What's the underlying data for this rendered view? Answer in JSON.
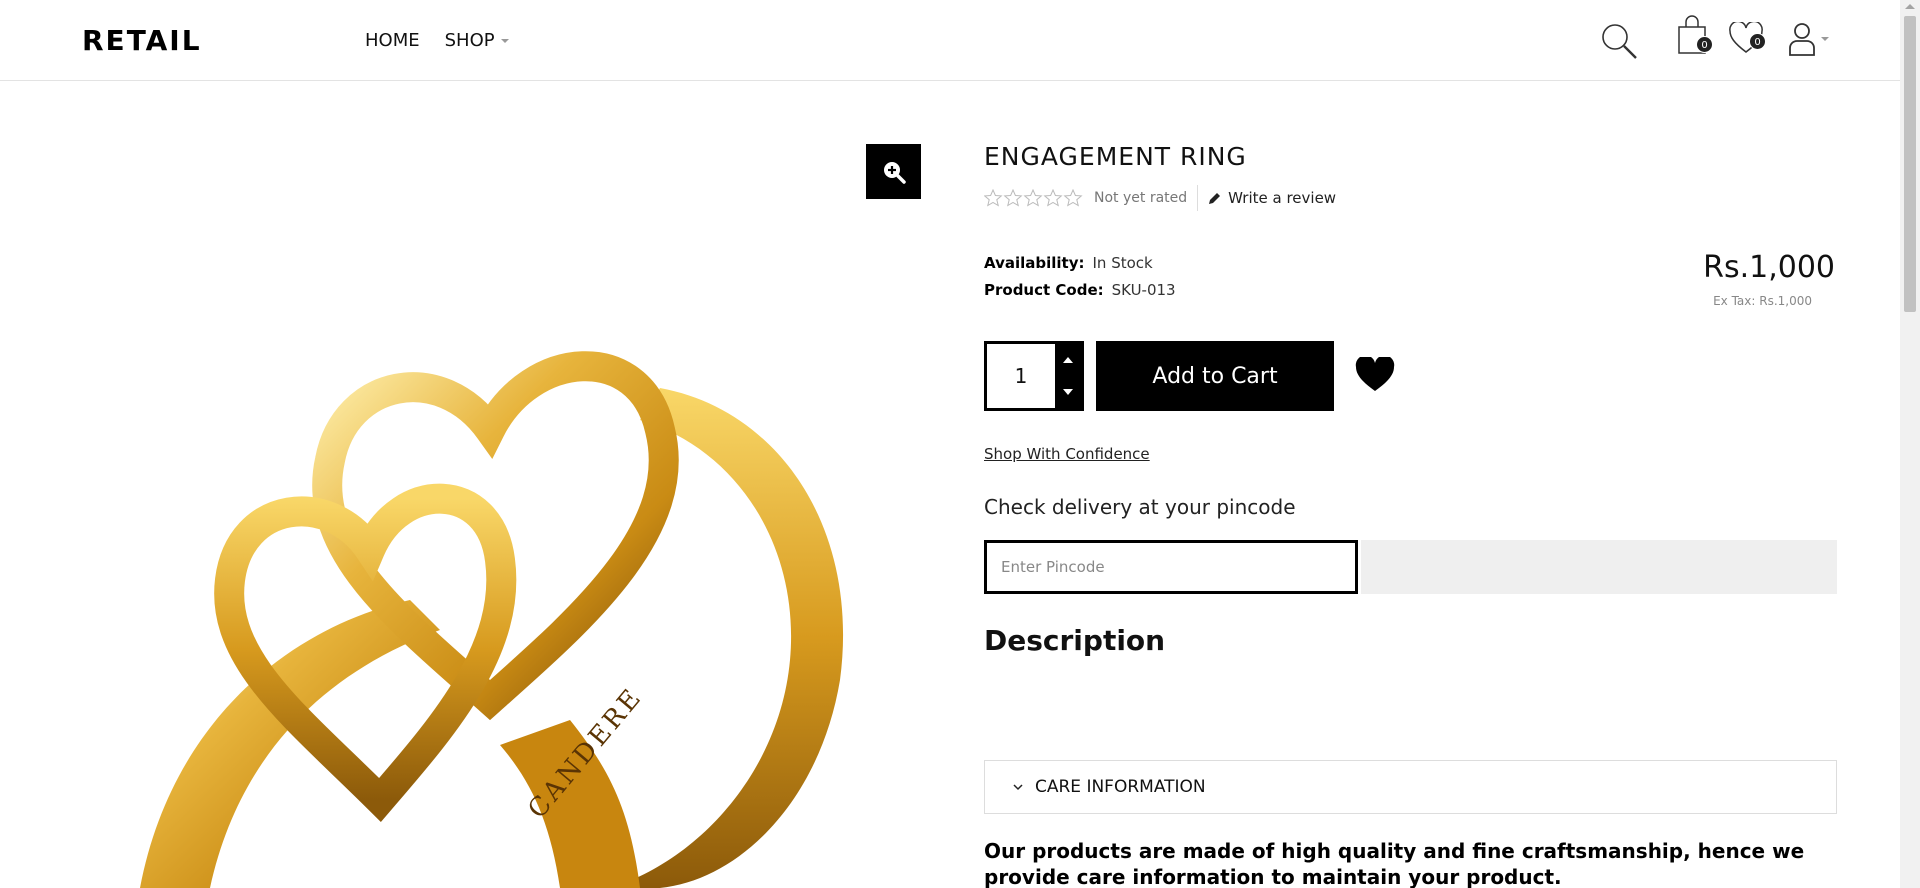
{
  "header": {
    "logo": "RETAIL",
    "nav": [
      {
        "label": "HOME"
      },
      {
        "label": "SHOP"
      }
    ],
    "cart_count": "0",
    "wishlist_count": "0"
  },
  "product": {
    "title": "ENGAGEMENT RING",
    "rating_text": "Not yet rated",
    "write_review": "Write a review",
    "availability_label": "Availability:",
    "availability_value": "In Stock",
    "code_label": "Product Code:",
    "code_value": "SKU-013",
    "price": "Rs.1,000",
    "ex_tax": "Ex Tax: Rs.1,000",
    "quantity": "1",
    "add_to_cart": "Add to Cart",
    "shop_confidence": "Shop With Confidence",
    "check_delivery": "Check delivery at your pincode",
    "pincode_placeholder": "Enter Pincode",
    "description_heading": "Description",
    "care_label": "CARE INFORMATION",
    "care_text": "Our products are made of high quality and fine craftsmanship, hence we provide care information to maintain your product.",
    "ring_engraving": "CANDERE"
  }
}
